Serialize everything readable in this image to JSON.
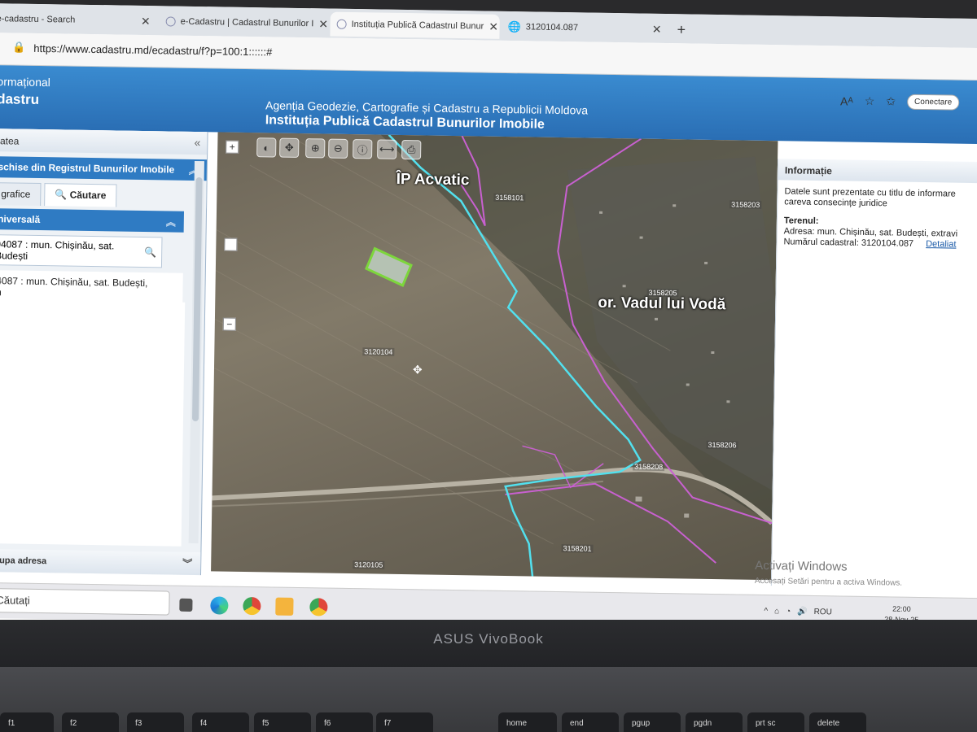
{
  "browser": {
    "tabs": [
      {
        "label": "e-cadastru - Search",
        "active": false
      },
      {
        "label": "e-Cadastru | Cadastrul Bunurilor I",
        "active": false
      },
      {
        "label": "Instituția Publică Cadastrul Bunur",
        "active": true
      },
      {
        "label": "3120104.087",
        "active": false
      }
    ],
    "url": "https://www.cadastru.md/ecadastru/f?p=100:1::::::#"
  },
  "site": {
    "brand_line1": "ormațional",
    "brand_line2": "dastru",
    "agency": "Agenția Geodezie, Cartografie și Cadastru a Republicii Moldova",
    "institution": "Instituția Publică Cadastrul Bunurilor Imobile",
    "connect_label": "Conectare"
  },
  "left_panel": {
    "header": "litatea",
    "section_title": "eschise din Registrul Bunurilor Imobile",
    "tabs": [
      "grafice",
      "Căutare"
    ],
    "subsection": "universală",
    "search_value": "04087 : mun. Chișinău, sat. Budești",
    "result_line1": "04087 : mun. Chișinău, sat. Budești,",
    "result_line2": "an",
    "footer": "e dupa adresa"
  },
  "map": {
    "labels": {
      "p1": "3158101",
      "p2": "3158203",
      "p3": "3158205",
      "p4": "3120104",
      "p5": "3158206",
      "p6": "3158208",
      "p7": "3158201",
      "p8": "3120105"
    },
    "place_acvatic": "ÎP Acvatic",
    "place_town": "or. Vadul lui Vodă",
    "zoom_in": "+",
    "zoom_out": "−"
  },
  "info_panel": {
    "title": "Informație",
    "notice": "Datele sunt prezentate cu titlu de informare careva consecințe juridice",
    "terrain_title": "Terenul:",
    "address": "Adresa: mun. Chișinău, sat. Budești, extravi",
    "cadastral": "Numărul cadastral: 3120104.087",
    "detail_link": "Detaliat"
  },
  "windows": {
    "activate_title": "Activați Windows",
    "activate_sub": "Accesați Setări pentru a activa Windows.",
    "search": "Căutați",
    "lang": "ROU",
    "time": "22:00",
    "date": "28-Nov-25"
  },
  "laptop": {
    "brand": "ASUS VivoBook",
    "keys": [
      "f1",
      "f2",
      "f3",
      "f4",
      "f5",
      "f6",
      "f7",
      "home",
      "end",
      "pgup",
      "pgdn",
      "prt sc",
      "delete"
    ]
  },
  "colors": {
    "banner_blue": "#2a6eb4",
    "boundary_cyan": "#52e0ee",
    "boundary_magenta": "#c860d0",
    "selected_parcel_green": "#7ddc3a"
  }
}
